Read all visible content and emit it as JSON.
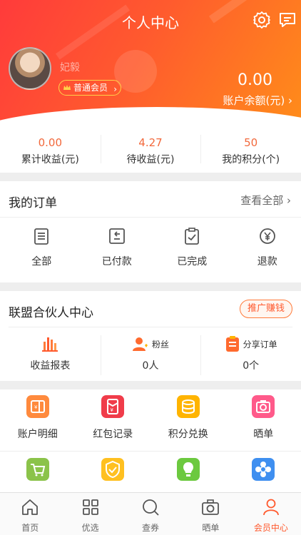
{
  "header": {
    "title": "个人中心",
    "username": "妃毅",
    "member_level": "普通会员",
    "balance_value": "0.00",
    "balance_label": "账户余额(元) ›",
    "settings_icon": "gear-icon",
    "message_icon": "message-icon"
  },
  "stats": [
    {
      "value": "0.00",
      "label": "累计收益(元)"
    },
    {
      "value": "4.27",
      "label": "待收益(元)"
    },
    {
      "value": "50",
      "label": "我的积分(个)"
    }
  ],
  "orders": {
    "title": "我的订单",
    "view_all": "查看全部 ›",
    "items": [
      {
        "label": "全部",
        "icon": "clipboard-icon"
      },
      {
        "label": "已付款",
        "icon": "paid-icon"
      },
      {
        "label": "已完成",
        "icon": "check-clipboard-icon"
      },
      {
        "label": "退款",
        "icon": "yen-refund-icon"
      }
    ]
  },
  "alliance": {
    "title": "联盟合伙人中心",
    "promote": "推广赚钱",
    "items": [
      {
        "label": "收益报表",
        "caption": "",
        "icon": "bar-chart-icon"
      },
      {
        "label": "0人",
        "caption": "粉丝",
        "icon": "fans-icon"
      },
      {
        "label": "0个",
        "caption": "分享订单",
        "icon": "share-order-icon"
      }
    ]
  },
  "grid": {
    "row1": [
      {
        "label": "账户明细",
        "icon": "account-detail-icon",
        "color": "#ff8a3d"
      },
      {
        "label": "红包记录",
        "icon": "red-packet-icon",
        "color": "#f03c4a"
      },
      {
        "label": "积分兑换",
        "icon": "coins-icon",
        "color": "#ffb400"
      },
      {
        "label": "晒单",
        "icon": "camera-icon",
        "color": "#ff5a8a"
      }
    ],
    "row2": [
      {
        "icon": "cart-icon",
        "color": "#8bc34a"
      },
      {
        "icon": "shield-check-icon",
        "color": "#ffc020"
      },
      {
        "icon": "bulb-icon",
        "color": "#6cc93f"
      },
      {
        "icon": "flower-icon",
        "color": "#3f8ff0"
      }
    ]
  },
  "tabbar": [
    {
      "label": "首页",
      "icon": "home-icon",
      "active": false
    },
    {
      "label": "优选",
      "icon": "grid-icon",
      "active": false
    },
    {
      "label": "查券",
      "icon": "search-icon",
      "active": false
    },
    {
      "label": "晒单",
      "icon": "camera-icon",
      "active": false
    },
    {
      "label": "会员中心",
      "icon": "user-icon",
      "active": true
    }
  ],
  "colors": {
    "accent": "#ff5a2e",
    "stat_value": "#f2683b"
  }
}
